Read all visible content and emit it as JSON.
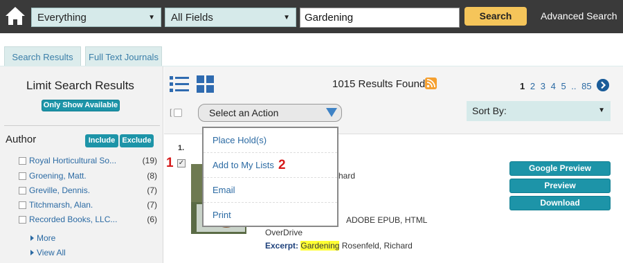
{
  "header": {
    "scope_select": "Everything",
    "field_select": "All Fields",
    "search_value": "Gardening",
    "search_button": "Search",
    "advanced_link": "Advanced Search"
  },
  "tabs": [
    {
      "label": "Search Results"
    },
    {
      "label": "Full Text Journals"
    }
  ],
  "sidebar": {
    "title": "Limit Search Results",
    "only_available": "Only Show Available",
    "author_heading": "Author",
    "include": "Include",
    "exclude": "Exclude",
    "authors": [
      {
        "name": "Royal Horticultural So...",
        "count": "(19)"
      },
      {
        "name": "Groening, Matt.",
        "count": "(8)"
      },
      {
        "name": "Greville, Dennis.",
        "count": "(7)"
      },
      {
        "name": "Titchmarsh, Alan.",
        "count": "(7)"
      },
      {
        "name": "Recorded Books, LLC...",
        "count": "(6)"
      }
    ],
    "more": "More",
    "view_all": "View All"
  },
  "toolbar": {
    "results_found": "1015 Results Found",
    "pages": [
      "1",
      "2",
      "3",
      "4",
      "5",
      "..",
      "85"
    ],
    "current_page": "1",
    "action_select": "Select an Action",
    "sort_by": "Sort By:"
  },
  "action_menu": [
    "Place Hold(s)",
    "Add to My Lists",
    "Email",
    "Print"
  ],
  "annotations": {
    "step1": "1",
    "step2": "2"
  },
  "result": {
    "number": "1.",
    "author_fragment": "hard",
    "format_fragment": "e:",
    "formats": "ADOBE EPUB, HTML",
    "source": "OverDrive",
    "excerpt_label": "Excerpt:",
    "excerpt_highlight": "Gardening",
    "excerpt_rest": " Rosenfeld, Richard",
    "buttons": [
      "Google Preview",
      "Preview",
      "Download"
    ]
  },
  "colors": {
    "header_bg": "#3a3a3a",
    "accent": "#1d94a8",
    "search_button": "#f5c55a",
    "annotation_red": "#d61a1a"
  }
}
